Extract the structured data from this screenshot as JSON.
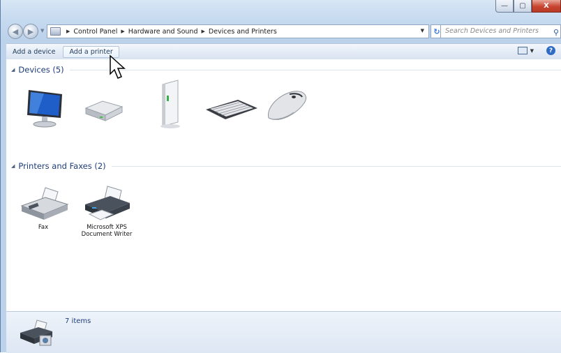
{
  "window": {
    "caption": {
      "minimize": "—",
      "maximize": "▢",
      "close": "X"
    }
  },
  "address_bar": {
    "breadcrumbs": [
      "Control Panel",
      "Hardware and Sound",
      "Devices and Printers"
    ],
    "search_placeholder": "Search Devices and Printers"
  },
  "toolbar": {
    "add_device": "Add a device",
    "add_printer": "Add a printer"
  },
  "groups": {
    "devices": {
      "header": "Devices (5)"
    },
    "printers": {
      "header": "Printers and Faxes (2)"
    }
  },
  "printers": [
    {
      "name": "Fax"
    },
    {
      "name": "Microsoft XPS Document Writer"
    }
  ],
  "status": {
    "items": "7 items"
  }
}
